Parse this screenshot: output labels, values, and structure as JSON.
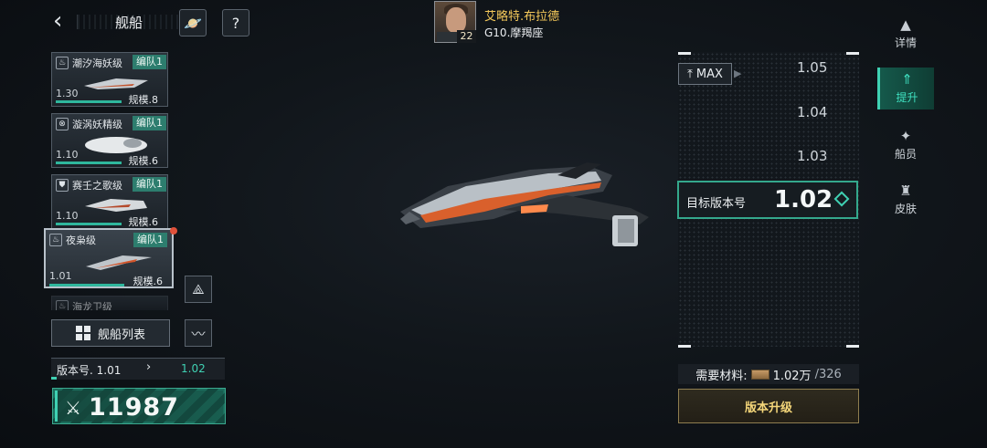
{
  "header": {
    "back_icon": "back-arrow-icon",
    "title": "舰船"
  },
  "captain": {
    "name": "艾略特.布拉德",
    "level": "22",
    "subtitle": "G10.摩羯座"
  },
  "ships": [
    {
      "name": "潮汐海妖级",
      "fleet": "编队1",
      "version": "1.30",
      "scale": "规模.8",
      "icon": "crest-icon"
    },
    {
      "name": "漩涡妖精级",
      "fleet": "编队1",
      "version": "1.10",
      "scale": "规模.6",
      "icon": "cross-circle-icon"
    },
    {
      "name": "赛壬之歌级",
      "fleet": "编队1",
      "version": "1.10",
      "scale": "规模.6",
      "icon": "shield-icon"
    },
    {
      "name": "夜枭级",
      "fleet": "编队1",
      "version": "1.01",
      "scale": "规模.6",
      "icon": "crest-icon"
    },
    {
      "name": "海龙卫级",
      "fleet": "",
      "version": "",
      "scale": "",
      "icon": "crest-icon"
    }
  ],
  "ship_list_button": "舰船列表",
  "version_line": {
    "label": "版本号. 1.01",
    "arrow": "›",
    "target": "1.02",
    "progress": 0.03
  },
  "power": {
    "value": "11987",
    "icon": "crossed-swords-icon"
  },
  "ladder": {
    "max_label": "MAX",
    "rungs": [
      "1.05",
      "1.04",
      "1.03"
    ],
    "target_label": "目标版本号",
    "target_value": "1.02"
  },
  "materials": {
    "label": "需要材料:",
    "amount": "1.02万",
    "owned": "/326"
  },
  "upgrade_button": "版本升级",
  "tabs": [
    {
      "label": "详情",
      "icon": "ship-icon",
      "active": false
    },
    {
      "label": "提升",
      "icon": "upgrade-icon",
      "active": true
    },
    {
      "label": "船员",
      "icon": "crew-icon",
      "active": false
    },
    {
      "label": "皮肤",
      "icon": "skin-icon",
      "active": false
    }
  ],
  "colors": {
    "accent": "#3fd1b3",
    "gold": "#f5d77a",
    "name_gold": "#f4c85a"
  }
}
